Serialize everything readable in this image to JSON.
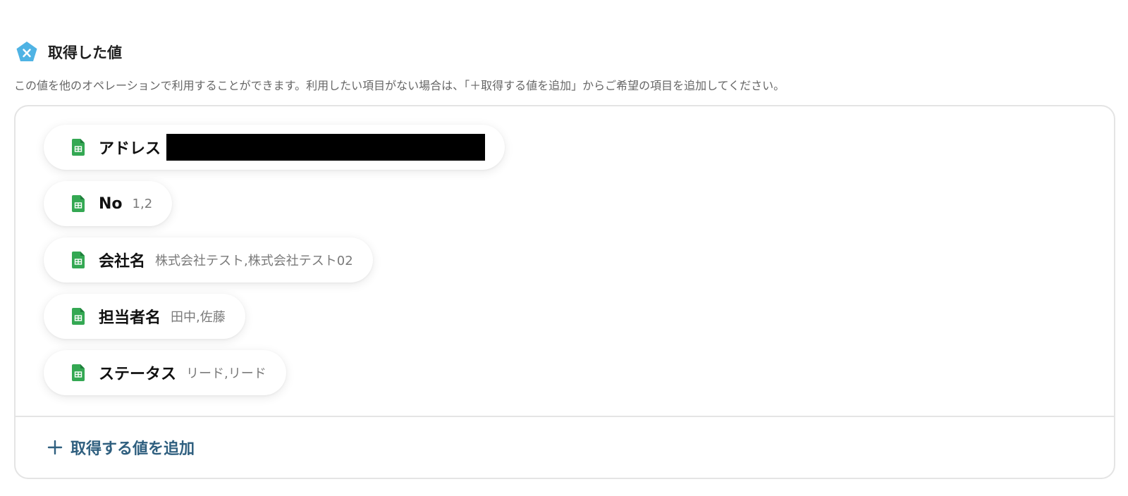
{
  "section": {
    "title": "取得した値",
    "description": "この値を他のオペレーションで利用することができます。利用したい項目がない場合は、「＋取得する値を追加」からご希望の項目を追加してください。",
    "header_icon": "variable-x-icon"
  },
  "values": [
    {
      "label": "アドレス",
      "value": "",
      "redacted": true,
      "icon": "google-sheets-icon"
    },
    {
      "label": "No",
      "value": "1,2",
      "icon": "google-sheets-icon"
    },
    {
      "label": "会社名",
      "value": "株式会社テスト,株式会社テスト02",
      "icon": "google-sheets-icon"
    },
    {
      "label": "担当者名",
      "value": "田中,佐藤",
      "icon": "google-sheets-icon"
    },
    {
      "label": "ステータス",
      "value": "リード,リード",
      "icon": "google-sheets-icon"
    }
  ],
  "add_button": {
    "label": "取得する値を追加",
    "icon": "plus-icon"
  },
  "colors": {
    "header_icon": "#4fb3e4",
    "sheets_green": "#34a853",
    "add_button_text": "#2f5f7f",
    "card_border": "#e4e4e4"
  }
}
